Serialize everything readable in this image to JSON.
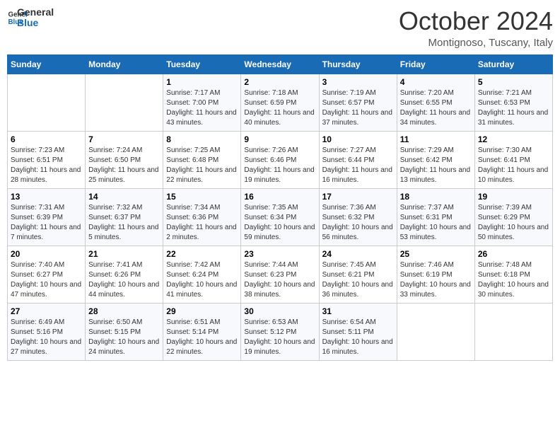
{
  "header": {
    "logo_general": "General",
    "logo_blue": "Blue",
    "month": "October 2024",
    "location": "Montignoso, Tuscany, Italy"
  },
  "weekdays": [
    "Sunday",
    "Monday",
    "Tuesday",
    "Wednesday",
    "Thursday",
    "Friday",
    "Saturday"
  ],
  "weeks": [
    [
      {
        "day": "",
        "sunrise": "",
        "sunset": "",
        "daylight": ""
      },
      {
        "day": "",
        "sunrise": "",
        "sunset": "",
        "daylight": ""
      },
      {
        "day": "1",
        "sunrise": "Sunrise: 7:17 AM",
        "sunset": "Sunset: 7:00 PM",
        "daylight": "Daylight: 11 hours and 43 minutes."
      },
      {
        "day": "2",
        "sunrise": "Sunrise: 7:18 AM",
        "sunset": "Sunset: 6:59 PM",
        "daylight": "Daylight: 11 hours and 40 minutes."
      },
      {
        "day": "3",
        "sunrise": "Sunrise: 7:19 AM",
        "sunset": "Sunset: 6:57 PM",
        "daylight": "Daylight: 11 hours and 37 minutes."
      },
      {
        "day": "4",
        "sunrise": "Sunrise: 7:20 AM",
        "sunset": "Sunset: 6:55 PM",
        "daylight": "Daylight: 11 hours and 34 minutes."
      },
      {
        "day": "5",
        "sunrise": "Sunrise: 7:21 AM",
        "sunset": "Sunset: 6:53 PM",
        "daylight": "Daylight: 11 hours and 31 minutes."
      }
    ],
    [
      {
        "day": "6",
        "sunrise": "Sunrise: 7:23 AM",
        "sunset": "Sunset: 6:51 PM",
        "daylight": "Daylight: 11 hours and 28 minutes."
      },
      {
        "day": "7",
        "sunrise": "Sunrise: 7:24 AM",
        "sunset": "Sunset: 6:50 PM",
        "daylight": "Daylight: 11 hours and 25 minutes."
      },
      {
        "day": "8",
        "sunrise": "Sunrise: 7:25 AM",
        "sunset": "Sunset: 6:48 PM",
        "daylight": "Daylight: 11 hours and 22 minutes."
      },
      {
        "day": "9",
        "sunrise": "Sunrise: 7:26 AM",
        "sunset": "Sunset: 6:46 PM",
        "daylight": "Daylight: 11 hours and 19 minutes."
      },
      {
        "day": "10",
        "sunrise": "Sunrise: 7:27 AM",
        "sunset": "Sunset: 6:44 PM",
        "daylight": "Daylight: 11 hours and 16 minutes."
      },
      {
        "day": "11",
        "sunrise": "Sunrise: 7:29 AM",
        "sunset": "Sunset: 6:42 PM",
        "daylight": "Daylight: 11 hours and 13 minutes."
      },
      {
        "day": "12",
        "sunrise": "Sunrise: 7:30 AM",
        "sunset": "Sunset: 6:41 PM",
        "daylight": "Daylight: 11 hours and 10 minutes."
      }
    ],
    [
      {
        "day": "13",
        "sunrise": "Sunrise: 7:31 AM",
        "sunset": "Sunset: 6:39 PM",
        "daylight": "Daylight: 11 hours and 7 minutes."
      },
      {
        "day": "14",
        "sunrise": "Sunrise: 7:32 AM",
        "sunset": "Sunset: 6:37 PM",
        "daylight": "Daylight: 11 hours and 5 minutes."
      },
      {
        "day": "15",
        "sunrise": "Sunrise: 7:34 AM",
        "sunset": "Sunset: 6:36 PM",
        "daylight": "Daylight: 11 hours and 2 minutes."
      },
      {
        "day": "16",
        "sunrise": "Sunrise: 7:35 AM",
        "sunset": "Sunset: 6:34 PM",
        "daylight": "Daylight: 10 hours and 59 minutes."
      },
      {
        "day": "17",
        "sunrise": "Sunrise: 7:36 AM",
        "sunset": "Sunset: 6:32 PM",
        "daylight": "Daylight: 10 hours and 56 minutes."
      },
      {
        "day": "18",
        "sunrise": "Sunrise: 7:37 AM",
        "sunset": "Sunset: 6:31 PM",
        "daylight": "Daylight: 10 hours and 53 minutes."
      },
      {
        "day": "19",
        "sunrise": "Sunrise: 7:39 AM",
        "sunset": "Sunset: 6:29 PM",
        "daylight": "Daylight: 10 hours and 50 minutes."
      }
    ],
    [
      {
        "day": "20",
        "sunrise": "Sunrise: 7:40 AM",
        "sunset": "Sunset: 6:27 PM",
        "daylight": "Daylight: 10 hours and 47 minutes."
      },
      {
        "day": "21",
        "sunrise": "Sunrise: 7:41 AM",
        "sunset": "Sunset: 6:26 PM",
        "daylight": "Daylight: 10 hours and 44 minutes."
      },
      {
        "day": "22",
        "sunrise": "Sunrise: 7:42 AM",
        "sunset": "Sunset: 6:24 PM",
        "daylight": "Daylight: 10 hours and 41 minutes."
      },
      {
        "day": "23",
        "sunrise": "Sunrise: 7:44 AM",
        "sunset": "Sunset: 6:23 PM",
        "daylight": "Daylight: 10 hours and 38 minutes."
      },
      {
        "day": "24",
        "sunrise": "Sunrise: 7:45 AM",
        "sunset": "Sunset: 6:21 PM",
        "daylight": "Daylight: 10 hours and 36 minutes."
      },
      {
        "day": "25",
        "sunrise": "Sunrise: 7:46 AM",
        "sunset": "Sunset: 6:19 PM",
        "daylight": "Daylight: 10 hours and 33 minutes."
      },
      {
        "day": "26",
        "sunrise": "Sunrise: 7:48 AM",
        "sunset": "Sunset: 6:18 PM",
        "daylight": "Daylight: 10 hours and 30 minutes."
      }
    ],
    [
      {
        "day": "27",
        "sunrise": "Sunrise: 6:49 AM",
        "sunset": "Sunset: 5:16 PM",
        "daylight": "Daylight: 10 hours and 27 minutes."
      },
      {
        "day": "28",
        "sunrise": "Sunrise: 6:50 AM",
        "sunset": "Sunset: 5:15 PM",
        "daylight": "Daylight: 10 hours and 24 minutes."
      },
      {
        "day": "29",
        "sunrise": "Sunrise: 6:51 AM",
        "sunset": "Sunset: 5:14 PM",
        "daylight": "Daylight: 10 hours and 22 minutes."
      },
      {
        "day": "30",
        "sunrise": "Sunrise: 6:53 AM",
        "sunset": "Sunset: 5:12 PM",
        "daylight": "Daylight: 10 hours and 19 minutes."
      },
      {
        "day": "31",
        "sunrise": "Sunrise: 6:54 AM",
        "sunset": "Sunset: 5:11 PM",
        "daylight": "Daylight: 10 hours and 16 minutes."
      },
      {
        "day": "",
        "sunrise": "",
        "sunset": "",
        "daylight": ""
      },
      {
        "day": "",
        "sunrise": "",
        "sunset": "",
        "daylight": ""
      }
    ]
  ]
}
